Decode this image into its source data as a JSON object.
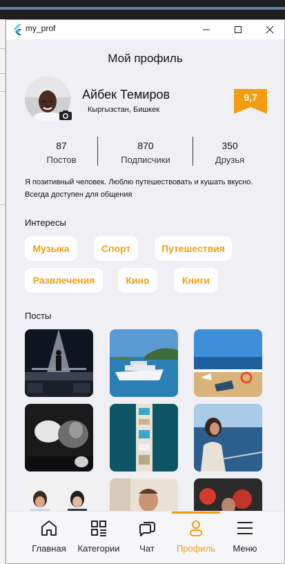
{
  "window": {
    "title": "my_prof"
  },
  "page": {
    "title": "Мой профиль"
  },
  "profile": {
    "name": "Айбек Темиров",
    "location": "Кыргызстан, Бишкек",
    "rating": "9,7",
    "bio": "Я позитивный человек. Люблю путешествовать и кушать вкусно. Всегда доступен для общения"
  },
  "stats": [
    {
      "value": "87",
      "label": "Постов"
    },
    {
      "value": "870",
      "label": "Подписчики"
    },
    {
      "value": "350",
      "label": "Друзья"
    }
  ],
  "interests": {
    "title": "Интересы",
    "items": [
      "Музыка",
      "Спорт",
      "Путешествия",
      "Развлечения",
      "Кино",
      "Книги"
    ]
  },
  "posts": {
    "title": "Посты",
    "images": [
      "boxing-ring-photo",
      "cruise-ship-photo",
      "ship-deck-photo",
      "boxing-glove-photo",
      "cruise-aerial-photo",
      "woman-sea-photo",
      "people-talking-photo",
      "smiling-man-photo",
      "boxing-match-photo"
    ]
  },
  "nav": {
    "items": [
      {
        "label": "Главная",
        "icon": "home-icon"
      },
      {
        "label": "Категории",
        "icon": "categories-icon"
      },
      {
        "label": "Чат",
        "icon": "chat-icon"
      },
      {
        "label": "Профиль",
        "icon": "profile-icon"
      },
      {
        "label": "Меню",
        "icon": "menu-icon"
      }
    ],
    "active": "Профиль"
  },
  "colors": {
    "accent": "#f29d0f",
    "background": "#f0eff4"
  }
}
